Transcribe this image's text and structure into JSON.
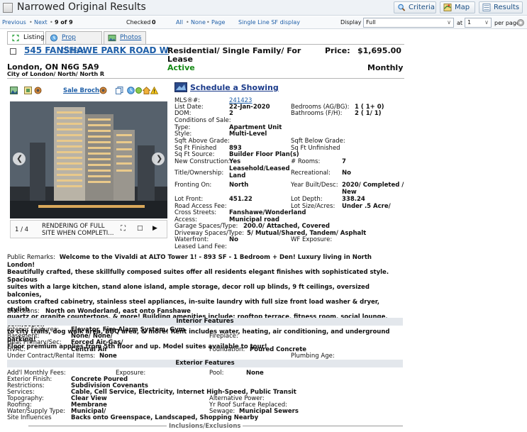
{
  "window": {
    "title": "Narrowed Original Results"
  },
  "toolbar": {
    "criteria_label": "Criteria",
    "map_label": "Map",
    "results_label": "Results",
    "previous": "Previous",
    "sep1": "•",
    "next": "Next",
    "sep2": "•",
    "position": "9 of 9",
    "checked_label": "Checked",
    "checked_count": "0",
    "all": "All",
    "sep3": "•",
    "none": "None",
    "sep4": "•",
    "page": "Page",
    "display_mode_link": "Single Line SF display",
    "display_label": "Display",
    "display_value": "Full",
    "at_label": "at",
    "at_value": "1",
    "per_page_label": "per page"
  },
  "tabs": [
    {
      "label": "Listing",
      "icon": "listing-icon"
    },
    {
      "label": "Prop History",
      "icon": "history-icon"
    },
    {
      "label": "Photos",
      "icon": "photos-icon"
    }
  ],
  "listing": {
    "address": "545 FANSHAWE PARK ROAD W",
    "city_line": "London, ON N6G 5A9",
    "area_line": "City of London/ North/ North R",
    "type_line1": "Residential/ Single Family/ For",
    "type_line2": "Lease",
    "status": "Active",
    "price_label": "Price:",
    "price": "$1,695.00",
    "price_period": "Monthly",
    "sale_broch": "Sale Broch",
    "schedule": "Schedule a Showing"
  },
  "gallery": {
    "counter": "1 / 4",
    "caption_line1": "RENDERING OF FULL",
    "caption_line2": "SITE WHEN COMPLETI..."
  },
  "details": {
    "mls_label": "MLS®#:",
    "mls": "241423",
    "list_date_label": "List Date:",
    "list_date": "22-Jan-2020",
    "dom_label": "DOM:",
    "dom": "2",
    "conditions_label": "Conditions of Sale:",
    "type_label": "Type:",
    "type": "Apartment Unit",
    "style_label": "Style:",
    "style": "Multi-Level",
    "sqft_above_label": "Sqft Above Grade:",
    "sqft_finished_label": "Sq Ft Finished",
    "sqft_finished": "893",
    "sqft_source_label": "Sq Ft Source:",
    "sqft_source": "Builder Floor Plan(s)",
    "new_construction_label": "New Construction:",
    "new_construction": "Yes",
    "title_label": "Title/Ownership:",
    "title_line1": "Leasehold/Leased",
    "title_line2": "Land",
    "fronting_label": "Fronting On:",
    "fronting": "North",
    "lot_front_label": "Lot Front:",
    "lot_front": "451.22",
    "road_access_label": "Road Access Fee:",
    "cross_streets_label": "Cross Streets:",
    "cross_streets": "Fanshawe/Wonderland",
    "access_label": "Access:",
    "access": "Municipal road",
    "garage_label": "Garage Spaces/Type:",
    "garage": "200.0/ Attached, Covered",
    "driveway_label": "Driveway Spaces/Type:",
    "driveway": "5/ Mutual/Shared, Tandem/ Asphalt",
    "waterfront_label": "Waterfront:",
    "waterfront": "No",
    "leased_land_fee_label": "Leased Land Fee:",
    "bedrooms_label": "Bedrooms (AG/BG):",
    "bedrooms": "1 ( 1+ 0)",
    "bathrooms_label": "Bathrooms (F/H):",
    "bathrooms": "2 ( 1/ 1)",
    "sqft_below_label": "Sqft Below Grade:",
    "sqft_unfinished_label": "Sq Ft Unfinished",
    "rooms_label": "# Rooms:",
    "rooms": "7",
    "recreational_label": "Recreational:",
    "recreational": "No",
    "year_built_label": "Year Built/Desc:",
    "year_built_line1": "2020/ Completed /",
    "year_built_line2": "New",
    "lot_depth_label": "Lot Depth:",
    "lot_depth": "338.24",
    "lot_size_label": "Lot Size/Acres:",
    "lot_size": "Under .5 Acre/",
    "wf_exposure_label": "WF Exposure:"
  },
  "remarks": {
    "label": "Public Remarks:",
    "lines": [
      "Welcome to the Vivaldi at ALTO Tower 1! - 893 SF - 1 Bedroom + Den! Luxury living in North London!",
      "Beautifully crafted, these skillfully composed suites offer all residents elegant finishes with sophisticated style. Spacious",
      "suites with a large kitchen, stand alone island, ample storage, decor roll up blinds, 9 ft ceilings, oversized balconies,",
      "custom crafted cabinetry, stainless steel appliances, in-suite laundry with full size front load washer & dryer, stylish",
      "quartz or granite countertops, & more! Building amenities include: rooftop terrace, fitness room, social lounge, connection",
      "to city trails, dog walk area, BBQ area, & more! Rent includes water, heating, air conditioning, and underground parking!",
      "Floor premium applies from 5th floor and up. Model suites available to tour!"
    ],
    "directions_label": "Directions:",
    "directions": "North on Wonderland, east onto Fanshawe"
  },
  "interior": {
    "heading": "Interior Features",
    "features_label": "Interior Features:",
    "features": "Elevator, Fire Alarm System, Gym",
    "basement_label": "Basement:",
    "basement": "None/ None/",
    "heat_label": "Heat Primary/Sec:",
    "heat": "Forced Air-Gas/",
    "hvac_label": "HVAC:",
    "hvac": "Central Air",
    "under_contract_label": "Under Contract/Rental Items:",
    "under_contract": "None",
    "fireplace_label": "Fireplace:",
    "foundation_label": "Foundation:",
    "foundation": "Poured Concrete",
    "plumbing_label": "Plumbing Age:"
  },
  "exterior": {
    "heading": "Exterior Features",
    "monthly_fees_label": "Add'l Monthly Fees:",
    "exposure_label": "Exposure:",
    "pool_label": "Pool:",
    "pool": "None",
    "finish_label": "Exterior Finish:",
    "finish": "Concrete Poured",
    "restrictions_label": "Restrictions:",
    "restrictions": "Subdivision Covenants",
    "services_label": "Services:",
    "services": "Cable, Cell Service, Electricity, Internet High-Speed, Public Transit",
    "topography_label": "Topography:",
    "topography": "Clear View",
    "alt_power_label": "Alternative Power:",
    "roofing_label": "Roofing:",
    "roofing": "Membrane",
    "roof_replaced_label": "Yr Roof Surface Replaced:",
    "water_label": "Water/Supply Type:",
    "water": "Municipal/",
    "sewage_label": "Sewage:",
    "sewage": "Municipal Sewers",
    "site_label": "Site Influences",
    "site": "Backs onto Greenspace, Landscaped, Shopping Nearby",
    "inclusions_heading": "Inclusions/Exclusions"
  }
}
